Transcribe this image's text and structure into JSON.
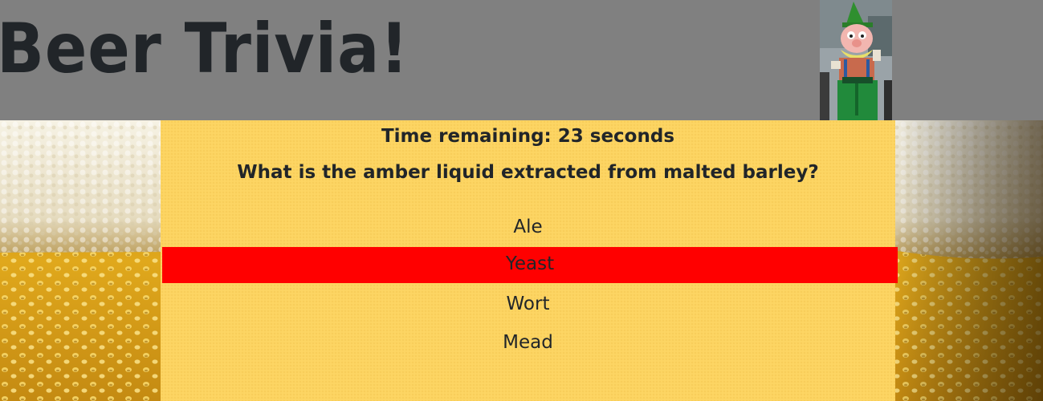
{
  "header": {
    "title": "Beer Trivia!"
  },
  "quiz": {
    "timer_text": "Time remaining: 23 seconds",
    "question": "What is the amber liquid extracted from malted barley?",
    "answers": [
      "Ale",
      "Yeast",
      "Wort",
      "Mead"
    ],
    "selected_answer": "Yeast",
    "selected_color": "#ff0000",
    "panel_color": "#fdd563"
  },
  "colors": {
    "header_bg": "#808080",
    "text": "#212529",
    "beer_amber": "#e0a81c",
    "foam": "#efe9d6"
  }
}
